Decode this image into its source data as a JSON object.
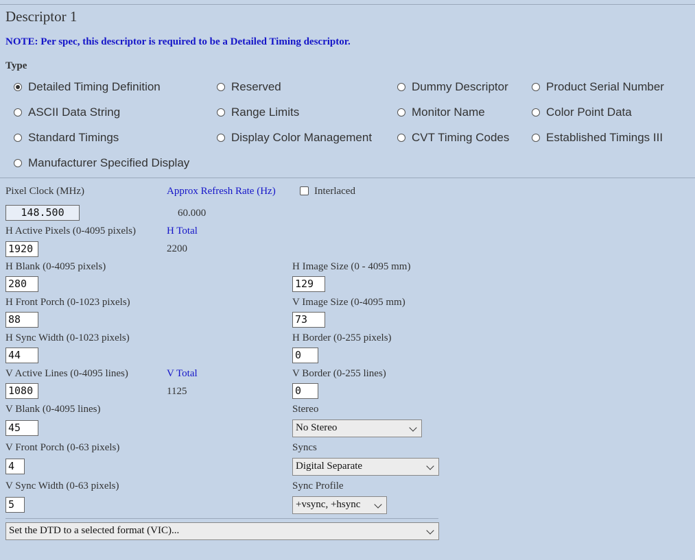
{
  "title": "Descriptor 1",
  "note": "NOTE: Per spec, this descriptor is required to be a Detailed Timing descriptor.",
  "type_label": "Type",
  "types": [
    {
      "label": "Detailed Timing Definition",
      "checked": true
    },
    {
      "label": "Reserved",
      "checked": false
    },
    {
      "label": "Dummy Descriptor",
      "checked": false
    },
    {
      "label": "Product Serial Number",
      "checked": false
    },
    {
      "label": "ASCII Data String",
      "checked": false
    },
    {
      "label": "Range Limits",
      "checked": false
    },
    {
      "label": "Monitor Name",
      "checked": false
    },
    {
      "label": "Color Point Data",
      "checked": false
    },
    {
      "label": "Standard Timings",
      "checked": false
    },
    {
      "label": "Display Color Management",
      "checked": false
    },
    {
      "label": "CVT Timing Codes",
      "checked": false
    },
    {
      "label": "Established Timings III",
      "checked": false
    },
    {
      "label": "Manufacturer Specified Display",
      "checked": false
    }
  ],
  "pixel_clock": {
    "label": "Pixel Clock (MHz)",
    "value": "148.500"
  },
  "refresh": {
    "label": "Approx Refresh Rate (Hz)",
    "value": "60.000"
  },
  "interlaced": {
    "label": "Interlaced",
    "checked": false
  },
  "h_active": {
    "label": "H Active Pixels (0-4095 pixels)",
    "value": "1920"
  },
  "h_total": {
    "label": "H Total",
    "value": "2200"
  },
  "h_blank": {
    "label": "H Blank (0-4095 pixels)",
    "value": "280"
  },
  "h_image": {
    "label": "H Image Size (0 - 4095 mm)",
    "value": "129"
  },
  "h_front": {
    "label": "H Front Porch (0-1023 pixels)",
    "value": "88"
  },
  "v_image": {
    "label": "V Image Size (0-4095 mm)",
    "value": "73"
  },
  "h_sync": {
    "label": "H Sync Width (0-1023 pixels)",
    "value": "44"
  },
  "h_border": {
    "label": "H Border (0-255 pixels)",
    "value": "0"
  },
  "v_active": {
    "label": "V Active Lines (0-4095 lines)",
    "value": "1080"
  },
  "v_total": {
    "label": "V Total",
    "value": "1125"
  },
  "v_border": {
    "label": "V Border (0-255 lines)",
    "value": "0"
  },
  "v_blank": {
    "label": "V Blank (0-4095 lines)",
    "value": "45"
  },
  "stereo": {
    "label": "Stereo",
    "value": "No Stereo"
  },
  "v_front": {
    "label": "V Front Porch (0-63 pixels)",
    "value": "4"
  },
  "syncs": {
    "label": "Syncs",
    "value": "Digital Separate"
  },
  "v_sync": {
    "label": "V Sync Width (0-63 pixels)",
    "value": "5"
  },
  "sync_profile": {
    "label": "Sync Profile",
    "value": "+vsync, +hsync"
  },
  "vic_select": {
    "value": "Set the DTD to a selected format (VIC)..."
  }
}
